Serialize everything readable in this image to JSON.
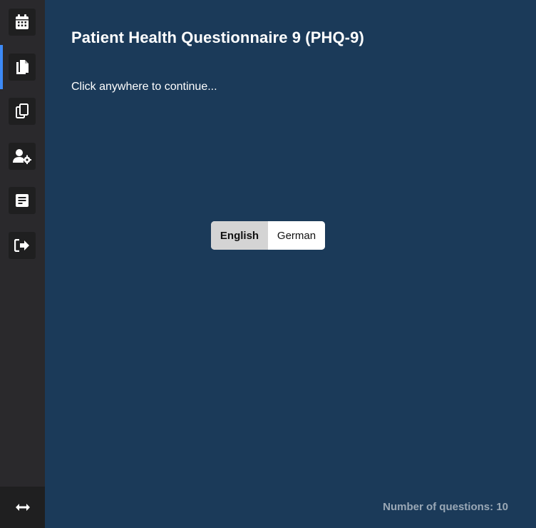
{
  "sidebar": {
    "items": [
      {
        "name": "calendar",
        "icon": "calendar-icon"
      },
      {
        "name": "documents",
        "icon": "documents-icon",
        "active": true
      },
      {
        "name": "copy",
        "icon": "copy-icon"
      },
      {
        "name": "user-settings",
        "icon": "user-cog-icon"
      },
      {
        "name": "report",
        "icon": "report-icon"
      },
      {
        "name": "logout",
        "icon": "sign-out-icon"
      }
    ],
    "footer_icon": "resize-horizontal-icon",
    "accent_color": "#3d8af7"
  },
  "main": {
    "title": "Patient Health Questionnaire 9 (PHQ-9)",
    "hint": "Click anywhere to continue...",
    "language": {
      "options": [
        "English",
        "German"
      ],
      "selected": "English"
    },
    "question_count_label": "Number of questions:",
    "question_count": "10"
  },
  "colors": {
    "background": "#1b3a59",
    "sidebar": "#2a292c"
  }
}
